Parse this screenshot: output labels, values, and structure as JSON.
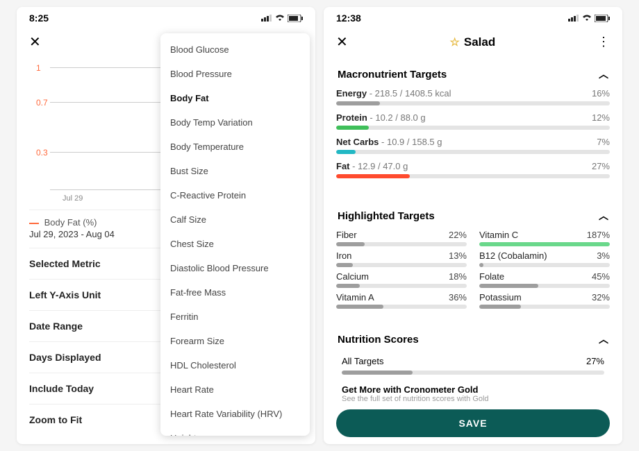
{
  "left": {
    "status_time": "8:25",
    "chart": {
      "y_ticks": [
        "1",
        "0.7",
        "0.3"
      ],
      "x_label": "Jul 29",
      "legend": "Body Fat (%)",
      "date_range": "Jul 29, 2023 - Aug 04"
    },
    "options": [
      "Selected Metric",
      "Left Y-Axis Unit",
      "Date Range",
      "Days Displayed",
      "Include Today",
      "Zoom to Fit"
    ],
    "dropdown": {
      "items": [
        "Blood Glucose",
        "Blood Pressure",
        "Body Fat",
        "Body Temp Variation",
        "Body Temperature",
        "Bust Size",
        "C-Reactive Protein",
        "Calf Size",
        "Chest Size",
        "Diastolic Blood Pressure",
        "Fat-free Mass",
        "Ferritin",
        "Forearm Size",
        "HDL Cholesterol",
        "Heart Rate",
        "Heart Rate Variability (HRV)",
        "Height"
      ],
      "selected_index": 2
    }
  },
  "right": {
    "status_time": "12:38",
    "title": "Salad",
    "macros_title": "Macronutrient Targets",
    "macros": [
      {
        "name": "Energy",
        "detail": " - 218.5 / 1408.5 kcal",
        "pct": "16%",
        "fill": 16,
        "color": "#9e9e9e"
      },
      {
        "name": "Protein",
        "detail": " - 10.2 / 88.0 g",
        "pct": "12%",
        "fill": 12,
        "color": "#3fbf5a"
      },
      {
        "name": "Net Carbs",
        "detail": " - 10.9 / 158.5 g",
        "pct": "7%",
        "fill": 7,
        "color": "#22b8c4"
      },
      {
        "name": "Fat",
        "detail": " - 12.9 / 47.0 g",
        "pct": "27%",
        "fill": 27,
        "color": "#ff4b2e"
      }
    ],
    "highlighted_title": "Highlighted Targets",
    "highlighted": [
      {
        "name": "Fiber",
        "pct": "22%",
        "fill": 22,
        "color": "#9e9e9e"
      },
      {
        "name": "Vitamin C",
        "pct": "187%",
        "fill": 100,
        "color": "#6ad88b"
      },
      {
        "name": "Iron",
        "pct": "13%",
        "fill": 13,
        "color": "#9e9e9e"
      },
      {
        "name": "B12 (Cobalamin)",
        "pct": "3%",
        "fill": 3,
        "color": "#9e9e9e"
      },
      {
        "name": "Calcium",
        "pct": "18%",
        "fill": 18,
        "color": "#9e9e9e"
      },
      {
        "name": "Folate",
        "pct": "45%",
        "fill": 45,
        "color": "#9e9e9e"
      },
      {
        "name": "Vitamin A",
        "pct": "36%",
        "fill": 36,
        "color": "#9e9e9e"
      },
      {
        "name": "Potassium",
        "pct": "32%",
        "fill": 32,
        "color": "#9e9e9e"
      }
    ],
    "scores_title": "Nutrition Scores",
    "score_label": "All Targets",
    "score_pct": "27%",
    "score_fill": 27,
    "gold_title": "Get More with Cronometer Gold",
    "gold_sub": "See the full set of nutrition scores with Gold",
    "save_label": "SAVE"
  },
  "chart_data": {
    "type": "line",
    "title": "Body Fat (%)",
    "x": [
      "Jul 29"
    ],
    "y_ticks": [
      0.3,
      0.7,
      1
    ],
    "series": [
      {
        "name": "Body Fat (%)",
        "values": []
      }
    ],
    "date_range": "Jul 29, 2023 - Aug 04"
  }
}
